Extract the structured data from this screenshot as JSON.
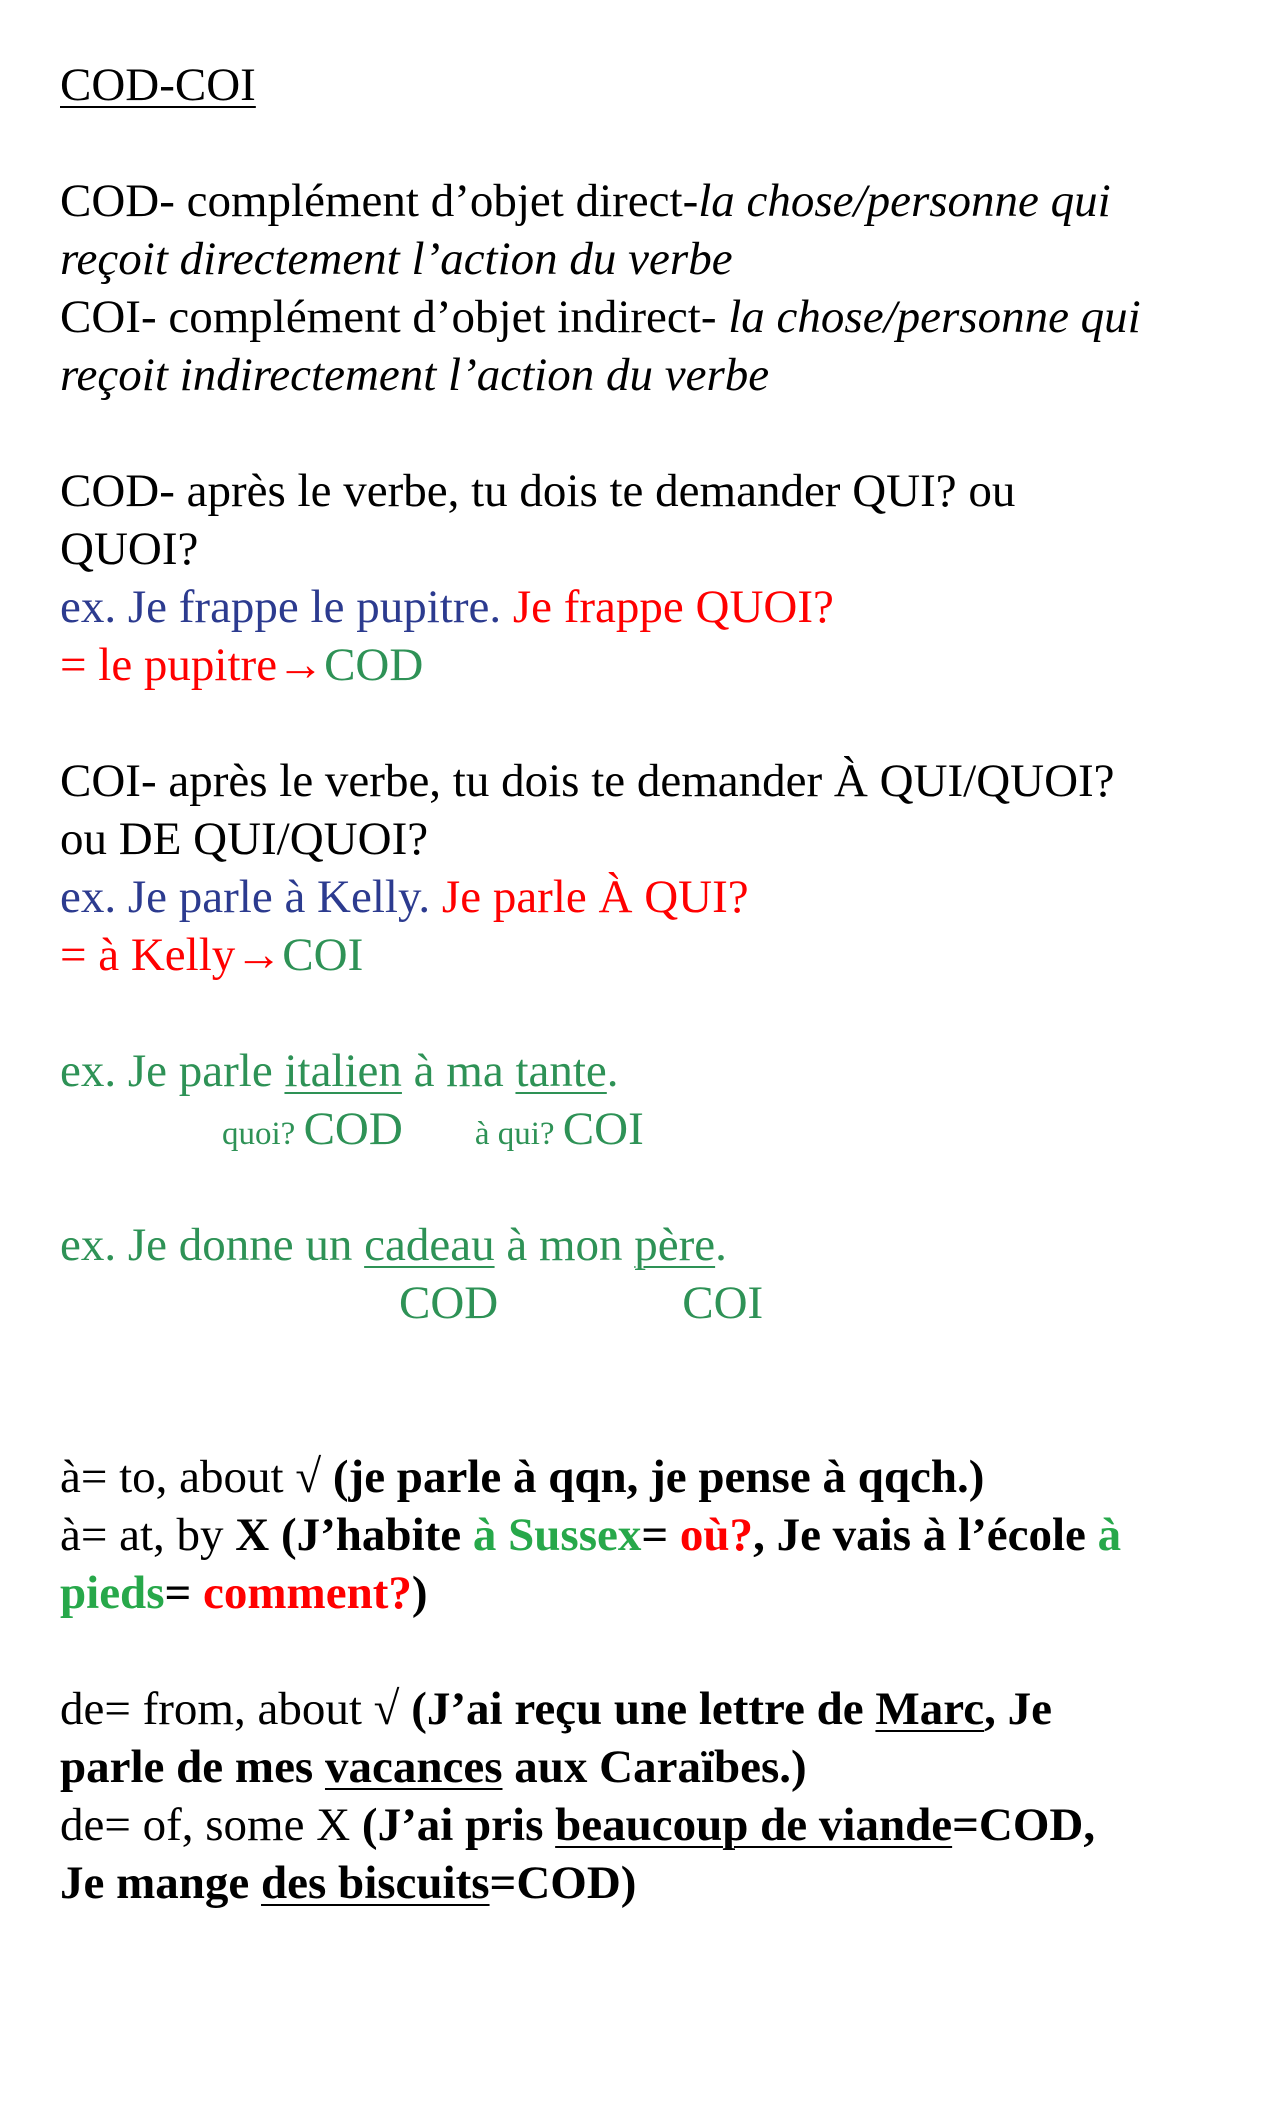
{
  "title": "COD-COI",
  "definitions": {
    "cod_prefix": "COD- complément d’objet direct-",
    "cod_def_1": "la chose/personne qui",
    "cod_def_2": "reçoit directement l’action du verbe",
    "coi_prefix": "COI- complément d’objet indirect- ",
    "coi_def_1": "la chose/personne qui",
    "coi_def_2": "reçoit indirectement l’action du verbe"
  },
  "cod_rule": {
    "line1": "COD- après le verbe, tu dois te demander QUI? ou",
    "line2": "QUOI?",
    "ex": "ex. Je frappe le pupitre. ",
    "question": "Je frappe QUOI?",
    "answer": "= le pupitre→",
    "tag": "COD"
  },
  "coi_rule": {
    "line1": "COI- après le verbe, tu dois te demander À QUI/QUOI?",
    "line2": "ou DE QUI/QUOI?",
    "ex": "ex. Je parle à Kelly. ",
    "question": "Je parle À QUI?",
    "answer": "= à Kelly→",
    "tag": "COI"
  },
  "example1": {
    "pre": "ex. Je parle ",
    "w1": "italien",
    "mid": " à ma ",
    "w2": "tante",
    "post": ".",
    "q1": "quoi? ",
    "t1": "COD",
    "q2": "à qui? ",
    "t2": "COI"
  },
  "example2": {
    "pre": "ex. Je donne un ",
    "w1": "cadeau",
    "mid": " à mon ",
    "w2": "père",
    "post": ".",
    "t1": "COD",
    "t2": "COI"
  },
  "a_section": {
    "l1_plain": "à= to, about √ ",
    "l1_bold": "(je parle à qqn, je pense à qqch.)",
    "l2_plain": "à= at, by ",
    "l2_b1": "X (J’habite ",
    "l2_g1": "à Sussex",
    "l2_b2": "= ",
    "l2_r1": "où?",
    "l2_b3": ", Je vais à l’école ",
    "l2_g2": "à",
    "l3_g": "pieds",
    "l3_b1": "= ",
    "l3_r": "comment?",
    "l3_b2": ")"
  },
  "de_section": {
    "l1_plain": "de= from, about √ ",
    "l1_b1": "(J’ai reçu une lettre de ",
    "l1_u": "Marc",
    "l1_b2": ", Je",
    "l2_b1": "parle de mes ",
    "l2_u": "vacances",
    "l2_b2": " aux Caraïbes.)",
    "l3_plain": "de= of, some X ",
    "l3_b1": "(J’ai pris ",
    "l3_u": "beaucoup de viande",
    "l3_b2": "=COD,",
    "l4_u": "des biscuits",
    "l4_b1": "Je mange ",
    "l4_b2": "=COD)"
  }
}
